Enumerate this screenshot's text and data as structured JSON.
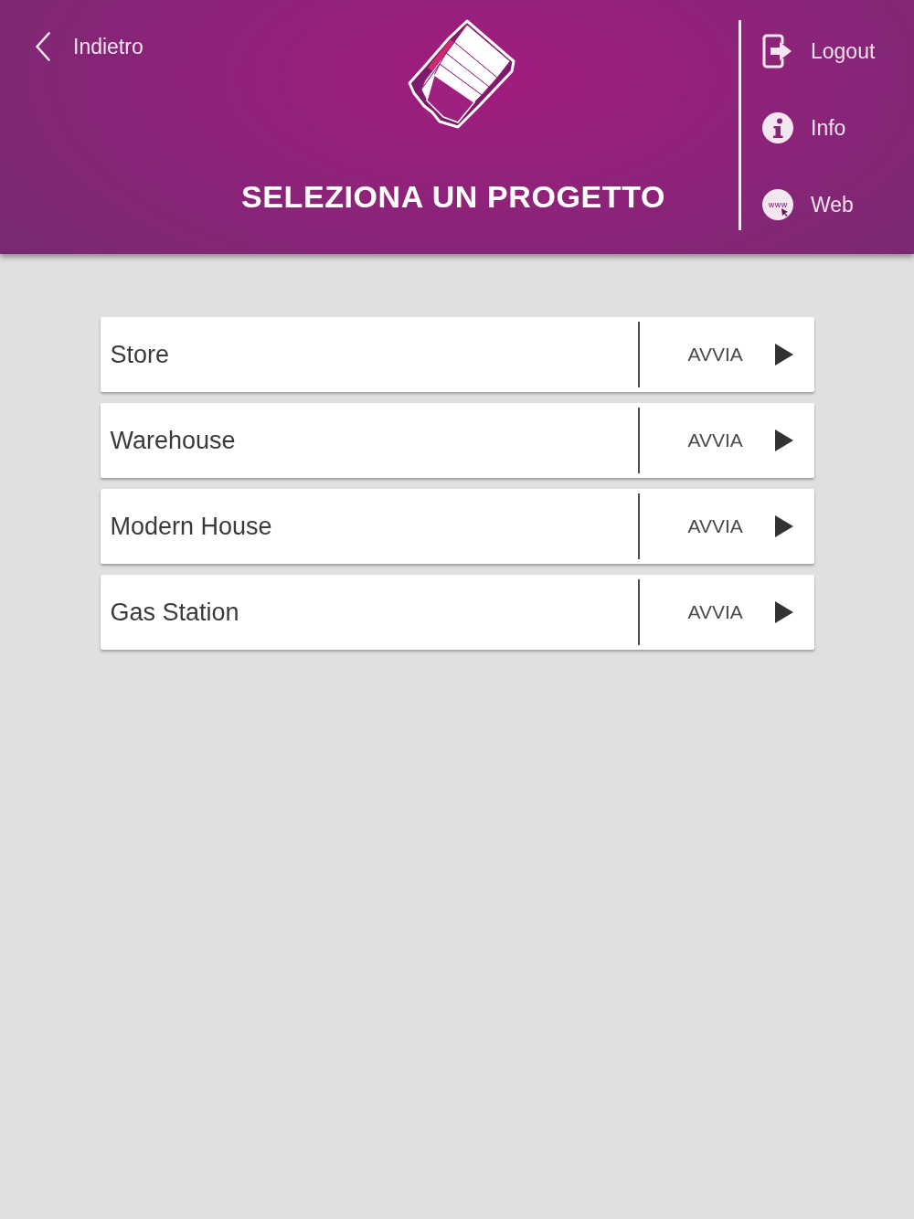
{
  "header": {
    "back_button": {
      "label": "Indietro"
    },
    "title": "SELEZIONA UN PROGETTO",
    "menu": [
      {
        "kind": "logout",
        "label": "Logout"
      },
      {
        "kind": "info",
        "label": "Info"
      },
      {
        "kind": "web",
        "label": "Web",
        "icon_text": "www"
      }
    ]
  },
  "projects": [
    {
      "name": "Store",
      "action": "AVVIA"
    },
    {
      "name": "Warehouse",
      "action": "AVVIA"
    },
    {
      "name": "Modern House",
      "action": "AVVIA"
    },
    {
      "name": "Gas Station",
      "action": "AVVIA"
    }
  ]
}
